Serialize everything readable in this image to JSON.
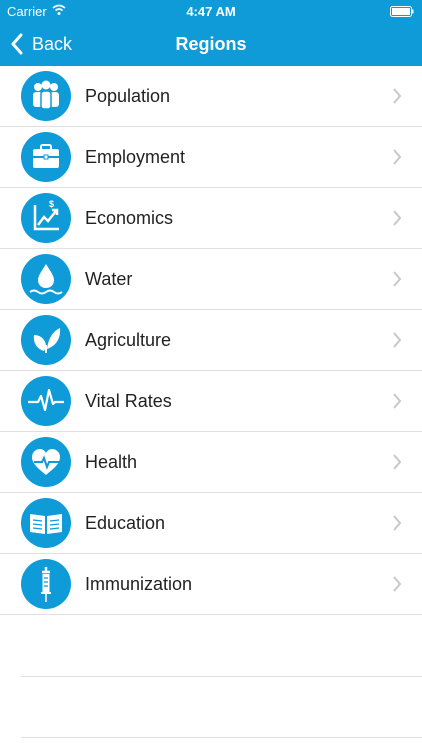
{
  "status_bar": {
    "carrier": "Carrier",
    "time": "4:47 AM"
  },
  "nav": {
    "back_label": "Back",
    "title": "Regions"
  },
  "accent_color": "#0f9bd8",
  "rows": [
    {
      "label": "Population",
      "icon": "population-icon"
    },
    {
      "label": "Employment",
      "icon": "briefcase-icon"
    },
    {
      "label": "Economics",
      "icon": "economics-chart-icon"
    },
    {
      "label": "Water",
      "icon": "water-drop-icon"
    },
    {
      "label": "Agriculture",
      "icon": "leaf-icon"
    },
    {
      "label": "Vital Rates",
      "icon": "heartbeat-pulse-icon"
    },
    {
      "label": "Health",
      "icon": "heart-pulse-icon"
    },
    {
      "label": "Education",
      "icon": "open-book-icon"
    },
    {
      "label": "Immunization",
      "icon": "syringe-icon"
    }
  ]
}
